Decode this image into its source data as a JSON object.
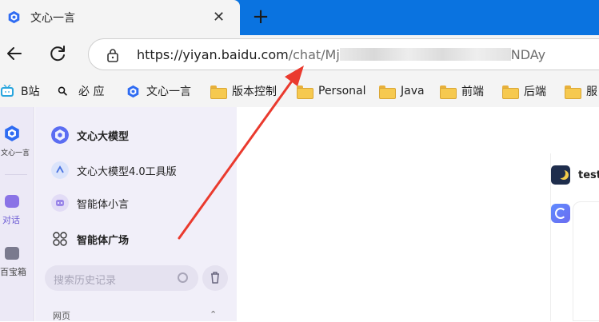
{
  "browser": {
    "tab": {
      "title": "文心一言",
      "close_glyph": "✕"
    },
    "new_tab_glyph": "+",
    "address": {
      "host": "https://yiyan.baidu.com",
      "path": "/chat/Mj",
      "tail": "NDAy"
    },
    "bookmarks": [
      {
        "label": "B站",
        "icon": "bilibili-icon"
      },
      {
        "label": "必 应",
        "icon": "search-icon"
      },
      {
        "label": "文心一言",
        "icon": "wenxin-icon"
      },
      {
        "label": "版本控制",
        "icon": "folder-icon"
      },
      {
        "label": "Personal",
        "icon": "folder-icon"
      },
      {
        "label": "Java",
        "icon": "folder-icon"
      },
      {
        "label": "前端",
        "icon": "folder-icon"
      },
      {
        "label": "后端",
        "icon": "folder-icon"
      },
      {
        "label": "服",
        "icon": "folder-icon"
      }
    ]
  },
  "rail": {
    "brand": "文心一言",
    "items": [
      {
        "label": "对话",
        "icon": "chat-icon"
      },
      {
        "label": "百宝箱",
        "icon": "toolbox-icon"
      }
    ]
  },
  "sidebar": {
    "items": [
      {
        "label": "文心大模型",
        "icon": "model-icon"
      },
      {
        "label": "文心大模型4.0工具版",
        "icon": "tool-model-icon"
      },
      {
        "label": "智能体小言",
        "icon": "agent-icon"
      },
      {
        "label": "智能体广场",
        "icon": "grid-icon"
      }
    ],
    "search_placeholder": "搜索历史记录",
    "section": "网页",
    "section_chevron": "⌃"
  },
  "main": {
    "user_message": "test"
  },
  "colors": {
    "tabbar": "#0a73e0",
    "arrow": "#ea3a2e",
    "accent": "#6c5bd4"
  }
}
